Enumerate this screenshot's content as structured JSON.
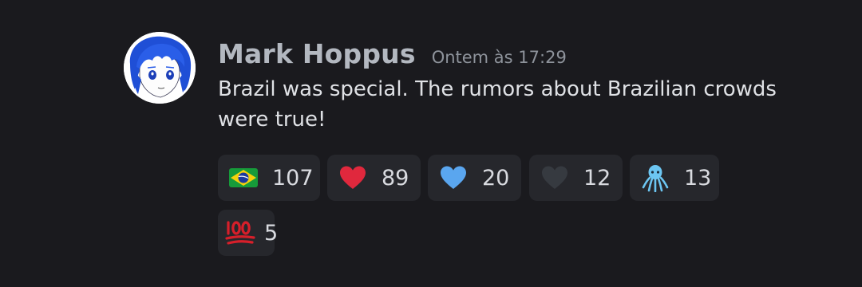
{
  "message": {
    "author": "Mark Hoppus",
    "timestamp": "Ontem às 17:29",
    "content": "Brazil was special. The rumors about Brazilian crowds were true!",
    "avatar_icon": "anime-girl-avatar"
  },
  "reactions": [
    {
      "emoji": "brazil-flag-icon",
      "count": "107"
    },
    {
      "emoji": "red-heart-icon",
      "count": "89"
    },
    {
      "emoji": "blue-heart-icon",
      "count": "20"
    },
    {
      "emoji": "black-heart-icon",
      "count": "12"
    },
    {
      "emoji": "octopus-icon",
      "count": "13"
    },
    {
      "emoji": "hundred-points-icon",
      "count": "5"
    }
  ],
  "colors": {
    "background": "#1a1a1e",
    "reaction_bg": "#26272c",
    "username": "#b3b8c0",
    "timestamp": "#8e939b",
    "text": "#dfe1e5"
  }
}
